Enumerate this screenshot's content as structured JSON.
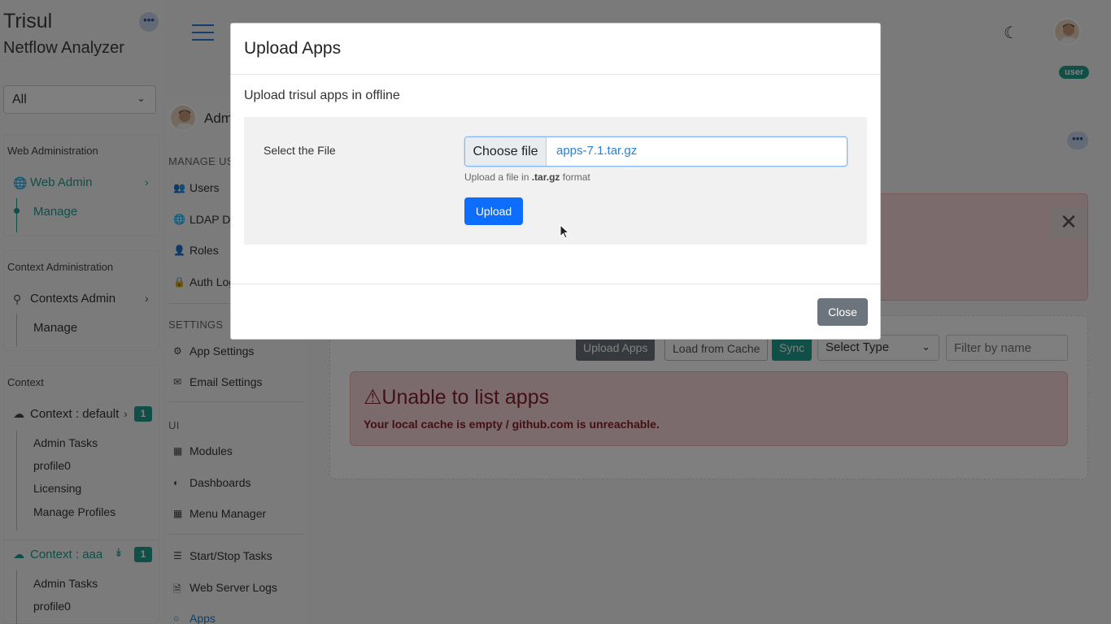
{
  "brand": {
    "title": "Trisul",
    "subtitle": "Netflow Analyzer"
  },
  "context_select": {
    "value": "All"
  },
  "sidebar": {
    "web_admin_section": "Web Administration",
    "web_admin_item": "Web Admin",
    "web_admin_sub": "Manage",
    "context_admin_section": "Context Administration",
    "contexts_admin_item": "Contexts Admin",
    "contexts_admin_sub": "Manage",
    "context_section": "Context",
    "context_default": "Context : default",
    "context_default_badge": "1",
    "default_items": [
      "Admin Tasks",
      "profile0",
      "Licensing",
      "Manage Profiles"
    ],
    "context_aaa": "Context : aaa",
    "context_aaa_badge": "1",
    "aaa_items": [
      "Admin Tasks",
      "profile0"
    ]
  },
  "admin_nav": {
    "admin_label": "Adm",
    "manage_users_heading": "MANAGE USE",
    "users": "Users",
    "ldap": "LDAP Do",
    "roles": "Roles",
    "auth_logs": "Auth Log",
    "settings_heading": "SETTINGS",
    "app_settings": "App Settings",
    "email_settings": "Email Settings",
    "ui_heading": "UI",
    "modules": "Modules",
    "dashboards": "Dashboards",
    "menu_manager": "Menu Manager",
    "start_stop": "Start/Stop Tasks",
    "web_server_logs": "Web Server Logs",
    "apps": "Apps"
  },
  "topbar": {
    "user_badge": "user"
  },
  "apps_panel": {
    "upload_apps": "Upload Apps",
    "load_cache": "Load from Cache",
    "sync": "Sync",
    "select_type": "Select Type",
    "filter_placeholder": "Filter by name",
    "alert_title": "Unable to list apps",
    "alert_message": "Your local cache is empty / github.com is unreachable."
  },
  "modal": {
    "title": "Upload Apps",
    "subtitle": "Upload trisul apps in offline",
    "file_label": "Select the File",
    "choose_file": "Choose file",
    "file_name": "apps-7.1.tar.gz",
    "help_prefix": "Upload a file in ",
    "help_format": ".tar.gz",
    "help_suffix": " format",
    "upload_button": "Upload",
    "close_button": "Close"
  },
  "colors": {
    "teal": "#1f9f8f",
    "primary": "#0d6efd",
    "danger_text": "#842029",
    "danger_bg": "#f8d7da"
  },
  "icons": [
    "ellipsis-icon",
    "chevron-down-icon",
    "globe-icon",
    "chevron-right-icon",
    "signpost-icon",
    "cloud-icon",
    "chevrons-down-icon",
    "hamburger-icon",
    "moon-icon",
    "users-icon",
    "key-icon",
    "user-icon",
    "lock-icon",
    "gear-icon",
    "envelope-icon",
    "grid-icon",
    "gauge-icon",
    "apps-grid-icon",
    "tasks-icon",
    "file-icon",
    "github-icon",
    "warning-icon",
    "close-icon",
    "cursor-icon"
  ]
}
